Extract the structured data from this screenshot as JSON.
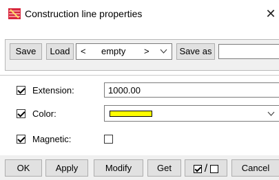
{
  "window": {
    "title": "Construction line properties",
    "close_glyph": "✕"
  },
  "toolbar": {
    "save_label": "Save",
    "load_label": "Load",
    "preset_left": "<",
    "preset_value": "empty",
    "preset_right": ">",
    "save_as_label": "Save as",
    "save_as_value": ""
  },
  "fields": {
    "extension": {
      "checked": true,
      "label": "Extension:",
      "value": "1000.00"
    },
    "color": {
      "checked": true,
      "label": "Color:",
      "swatch_color": "#ffff00"
    },
    "magnetic": {
      "checked": true,
      "label": "Magnetic:",
      "value_checked": false
    }
  },
  "buttons": {
    "ok": "OK",
    "apply": "Apply",
    "modify": "Modify",
    "get": "Get",
    "toggle_separator": "/",
    "cancel": "Cancel"
  }
}
